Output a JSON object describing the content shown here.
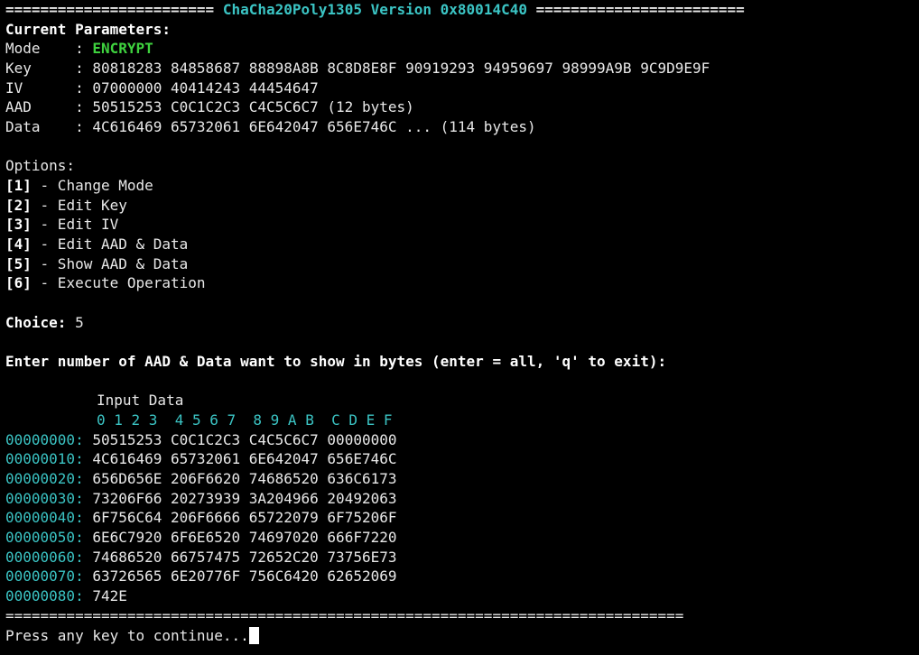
{
  "banner": {
    "left": "========================",
    "title": "ChaCha20Poly1305 Version 0x80014C40",
    "right": "========================"
  },
  "params": {
    "heading": "Current Parameters:",
    "mode": {
      "label": "Mode    : ",
      "value": "ENCRYPT"
    },
    "key": {
      "label": "Key     : ",
      "value": "80818283 84858687 88898A8B 8C8D8E8F 90919293 94959697 98999A9B 9C9D9E9F"
    },
    "iv": {
      "label": "IV      : ",
      "value": "07000000 40414243 44454647"
    },
    "aad": {
      "label": "AAD     : ",
      "value": "50515253 C0C1C2C3 C4C5C6C7 (12 bytes)"
    },
    "data": {
      "label": "Data    : ",
      "value": "4C616469 65732061 6E642047 656E746C ... (114 bytes)"
    }
  },
  "options": {
    "heading": "Options:",
    "items": [
      {
        "key": "[1]",
        "label": " - Change Mode"
      },
      {
        "key": "[2]",
        "label": " - Edit Key"
      },
      {
        "key": "[3]",
        "label": " - Edit IV"
      },
      {
        "key": "[4]",
        "label": " - Edit AAD & Data"
      },
      {
        "key": "[5]",
        "label": " - Show AAD & Data"
      },
      {
        "key": "[6]",
        "label": " - Execute Operation"
      }
    ]
  },
  "choice": {
    "label": "Choice:",
    "value": " 5"
  },
  "prompt": "Enter number of AAD & Data want to show in bytes (enter = all, 'q' to exit):",
  "hexdump": {
    "title": "Input Data",
    "columns": "0 1 2 3  4 5 6 7  8 9 A B  C D E F",
    "rows": [
      {
        "addr": "00000000:",
        "bytes": " 50515253 C0C1C2C3 C4C5C6C7 00000000"
      },
      {
        "addr": "00000010:",
        "bytes": " 4C616469 65732061 6E642047 656E746C"
      },
      {
        "addr": "00000020:",
        "bytes": " 656D656E 206F6620 74686520 636C6173"
      },
      {
        "addr": "00000030:",
        "bytes": " 73206F66 20273939 3A204966 20492063"
      },
      {
        "addr": "00000040:",
        "bytes": " 6F756C64 206F6666 65722079 6F75206F"
      },
      {
        "addr": "00000050:",
        "bytes": " 6E6C7920 6F6E6520 74697020 666F7220"
      },
      {
        "addr": "00000060:",
        "bytes": " 74686520 66757475 72652C20 73756E73"
      },
      {
        "addr": "00000070:",
        "bytes": " 63726565 6E20776F 756C6420 62652069"
      },
      {
        "addr": "00000080:",
        "bytes": " 742E"
      }
    ]
  },
  "separator": "==============================================================================",
  "continue_prompt": "Press any key to continue...",
  "colors": {
    "background": "#000000",
    "text": "#e8e8e8",
    "cyan": "#3bc4c4",
    "green": "#3ed13e"
  }
}
